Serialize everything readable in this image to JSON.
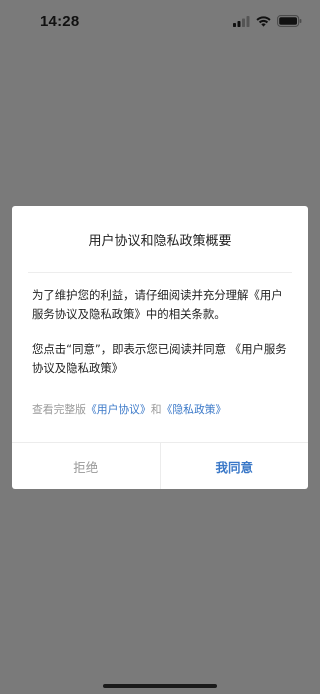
{
  "status_bar": {
    "time": "14:28",
    "icons": [
      "cellular-signal-icon",
      "wifi-icon",
      "battery-icon"
    ]
  },
  "dialog": {
    "title": "用户协议和隐私政策概要",
    "paragraph_1": "为了维护您的利益，请仔细阅读并充分理解《用户服务协议及隐私政策》中的相关条款。",
    "paragraph_2": "您点击“同意”，即表示您已阅读并同意 《用户服务协议及隐私政策》",
    "link_line": {
      "prefix": "查看完整版",
      "user_agreement_link": "《用户协议》",
      "conjunction": "和",
      "privacy_policy_link": "《隐私政策》"
    },
    "buttons": {
      "reject": "拒绝",
      "agree": "我同意"
    }
  },
  "colors": {
    "overlay": "#7a7a7a",
    "dialog_background": "#ffffff",
    "link": "#3a78c8",
    "muted": "#999999"
  }
}
